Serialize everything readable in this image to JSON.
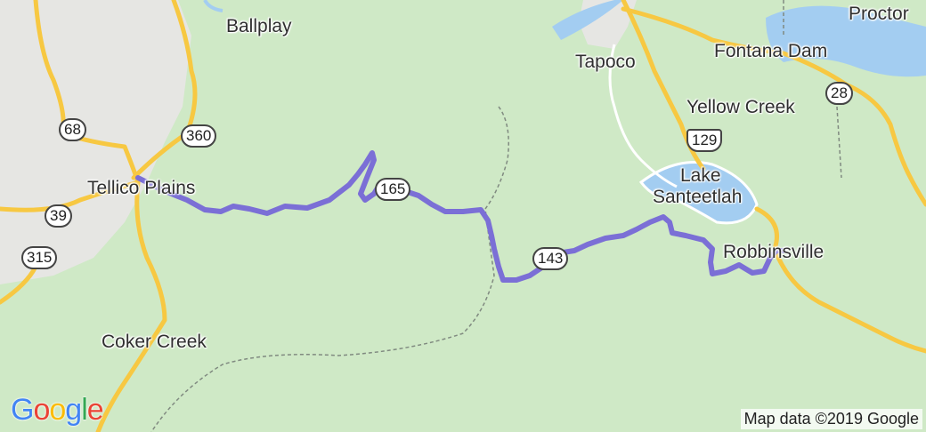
{
  "map": {
    "colors": {
      "land": "#cfe9c6",
      "urban": "#e6e6e3",
      "water": "#a3cdf1",
      "road_major": "#f7c842",
      "road_minor": "#ffffff",
      "route": "#7b6fd6",
      "boundary": "#808a80"
    },
    "places": [
      {
        "id": "ballplay",
        "name": "Ballplay"
      },
      {
        "id": "tellico-plains",
        "name": "Tellico Plains"
      },
      {
        "id": "coker-creek",
        "name": "Coker Creek"
      },
      {
        "id": "tapoco",
        "name": "Tapoco"
      },
      {
        "id": "fontana-dam",
        "name": "Fontana Dam"
      },
      {
        "id": "proctor",
        "name": "Proctor"
      },
      {
        "id": "yellow-creek",
        "name": "Yellow Creek"
      },
      {
        "id": "lake-santeetlah-1",
        "name": "Lake"
      },
      {
        "id": "lake-santeetlah-2",
        "name": "Santeetlah"
      },
      {
        "id": "robbinsville",
        "name": "Robbinsville"
      }
    ],
    "shields": [
      {
        "id": "68",
        "label": "68",
        "type": "state"
      },
      {
        "id": "360",
        "label": "360",
        "type": "state"
      },
      {
        "id": "39",
        "label": "39",
        "type": "state"
      },
      {
        "id": "315",
        "label": "315",
        "type": "state"
      },
      {
        "id": "165",
        "label": "165",
        "type": "state"
      },
      {
        "id": "143",
        "label": "143",
        "type": "state"
      },
      {
        "id": "129",
        "label": "129",
        "type": "us"
      },
      {
        "id": "28",
        "label": "28",
        "type": "state"
      }
    ],
    "route_name": "",
    "logo": "Google",
    "attribution": "Map data ©2019 Google"
  }
}
